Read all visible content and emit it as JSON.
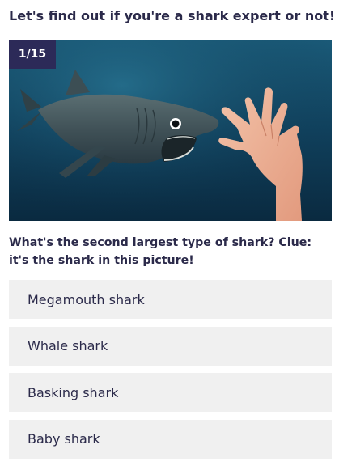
{
  "quiz": {
    "headline": "Let's find out if you're a shark expert or not!",
    "progress": "1/15",
    "image": {
      "subject": "basking shark swimming toward a human hand"
    },
    "question": "What's the second largest type of shark? Clue: it's the shark in this picture!",
    "answers": [
      {
        "label": "Megamouth shark"
      },
      {
        "label": "Whale shark"
      },
      {
        "label": "Basking shark"
      },
      {
        "label": "Baby shark"
      }
    ]
  },
  "colors": {
    "text": "#2b2a4a",
    "counter_bg": "#2c2a58",
    "answer_bg": "#f0f0f0",
    "water": "#0f3b55"
  }
}
